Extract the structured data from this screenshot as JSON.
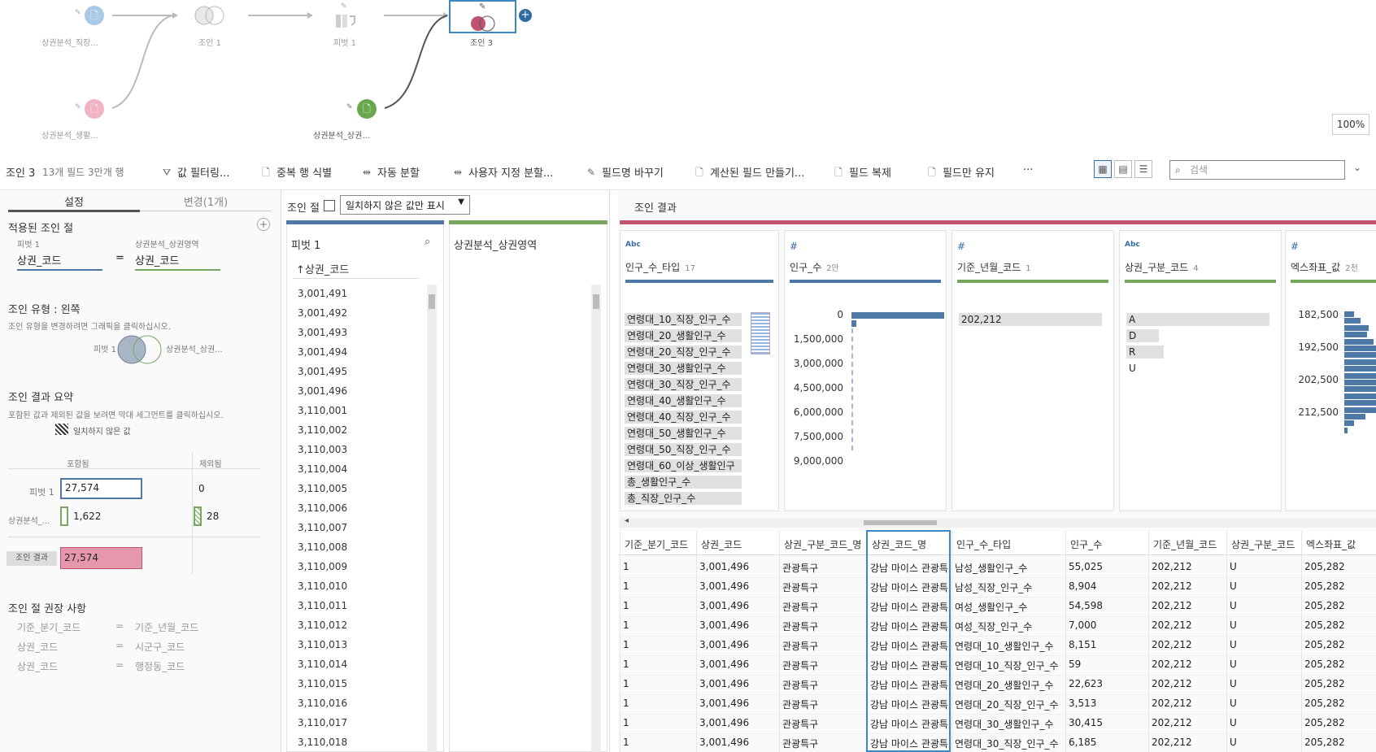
{
  "flow": {
    "nodes": {
      "src1": "상권분석_직장...",
      "join1": "조인 1",
      "pivot1": "피벗 1",
      "join3": "조인 3",
      "src2": "상권분석_생활...",
      "src3": "상권분석_상권..."
    },
    "zoom": "100%"
  },
  "toolbar": {
    "step_name": "조인 3",
    "step_meta": "13개 필드 3만개 행",
    "items": [
      "값 필터링...",
      "중복 행 식별",
      "자동 분할",
      "사용자 지정 분할...",
      "필드명 바꾸기",
      "계산된 필드 만들기...",
      "필드 복제",
      "필드만 유지",
      "···"
    ],
    "search_placeholder": "검색"
  },
  "left": {
    "tabs": [
      "설정",
      "변경(1개)"
    ],
    "applied_title": "적용된 조인 절",
    "left_source": "피벗 1",
    "right_source": "상권분석_상권영역",
    "left_field": "상권_코드",
    "eq": "=",
    "right_field": "상권_코드",
    "join_type_title": "조인 유형 : 왼쪽",
    "join_type_hint": "조인 유형을 변경하려면 그래픽을 클릭하십시오.",
    "venn_left": "피벗 1",
    "venn_right": "상권분석_상권...",
    "summary_title": "조인 결과 요약",
    "summary_hint": "포함된 값과 제외된 값을 보려면 막대 세그먼트를 클릭하십시오.",
    "unmatched_label": "일치하지 않은 값",
    "col_included": "포함됨",
    "col_excluded": "제외됨",
    "row1_label": "피벗 1",
    "row1_included": "27,574",
    "row1_excluded": "0",
    "row2_label": "상권분석_...",
    "row2_included": "1,622",
    "row2_excluded": "28",
    "row3_label": "조인 결과",
    "row3_included": "27,574",
    "rec_title": "조인 절 권장 사항",
    "recs": [
      {
        "l": "기준_분기_코드",
        "eq": "=",
        "r": "기준_년월_코드"
      },
      {
        "l": "상권_코드",
        "eq": "=",
        "r": "시군구_코드"
      },
      {
        "l": "상권_코드",
        "eq": "=",
        "r": "행정동_코드"
      }
    ]
  },
  "middle": {
    "title": "조인 절",
    "dropdown": "일치하지 않은 값만 표시",
    "left_source": "피벗 1",
    "right_source": "상권분석_상권영역",
    "field_header": "↑상권_코드",
    "values": [
      "3,001,491",
      "3,001,492",
      "3,001,493",
      "3,001,494",
      "3,001,495",
      "3,001,496",
      "3,110,001",
      "3,110,002",
      "3,110,003",
      "3,110,004",
      "3,110,005",
      "3,110,006",
      "3,110,007",
      "3,110,008",
      "3,110,009",
      "3,110,010",
      "3,110,011",
      "3,110,012",
      "3,110,013",
      "3,110,014",
      "3,110,015",
      "3,110,016",
      "3,110,017",
      "3,110,018"
    ]
  },
  "right": {
    "title": "조인 결과",
    "profiles": [
      {
        "type": "Abc",
        "name": "인구_수_타입",
        "count": "17",
        "color": "#4e79a7",
        "categories": [
          "연령대_10_직장_인구_수",
          "연령대_20_생활인구_수",
          "연령대_20_직장_인구_수",
          "연령대_30_생활인구_수",
          "연령대_30_직장_인구_수",
          "연령대_40_생활인구_수",
          "연령대_40_직장_인구_수",
          "연령대_50_생활인구_수",
          "연령대_50_직장_인구_수",
          "연령대_60_이상_생활인구",
          "총_생활인구_수",
          "총_직장_인구_수"
        ]
      },
      {
        "type": "#",
        "name": "인구_수",
        "count": "2만",
        "color": "#4e79a7",
        "ticks": [
          "0",
          "1,500,000",
          "3,000,000",
          "4,500,000",
          "6,000,000",
          "7,500,000",
          "9,000,000"
        ]
      },
      {
        "type": "#",
        "name": "기준_년월_코드",
        "count": "1",
        "color": "#76a660",
        "categories": [
          "202,212"
        ]
      },
      {
        "type": "Abc",
        "name": "상권_구분_코드",
        "count": "4",
        "color": "#76a660",
        "categories": [
          "A",
          "D",
          "R",
          "U"
        ]
      },
      {
        "type": "#",
        "name": "엑스좌표_값",
        "count": "2천",
        "color": "#76a660",
        "ticks": [
          "182,500",
          "192,500",
          "202,500",
          "212,500"
        ]
      }
    ],
    "columns": [
      "기준_분기_코드",
      "상권_코드",
      "상권_구분_코드_명",
      "상권_코드_명",
      "인구_수_타입",
      "인구_수",
      "기준_년월_코드",
      "상권_구분_코드",
      "엑스좌표_값"
    ],
    "rows": [
      [
        "1",
        "3,001,496",
        "관광특구",
        "강남 마이스 관광특",
        "남성_생활인구_수",
        "55,025",
        "202,212",
        "U",
        "205,282"
      ],
      [
        "1",
        "3,001,496",
        "관광특구",
        "강남 마이스 관광특",
        "남성_직장_인구_수",
        "8,904",
        "202,212",
        "U",
        "205,282"
      ],
      [
        "1",
        "3,001,496",
        "관광특구",
        "강남 마이스 관광특",
        "여성_생활인구_수",
        "54,598",
        "202,212",
        "U",
        "205,282"
      ],
      [
        "1",
        "3,001,496",
        "관광특구",
        "강남 마이스 관광특",
        "여성_직장_인구_수",
        "7,000",
        "202,212",
        "U",
        "205,282"
      ],
      [
        "1",
        "3,001,496",
        "관광특구",
        "강남 마이스 관광특",
        "연령대_10_생활인구_수",
        "8,151",
        "202,212",
        "U",
        "205,282"
      ],
      [
        "1",
        "3,001,496",
        "관광특구",
        "강남 마이스 관광특",
        "연령대_10_직장_인구_수",
        "59",
        "202,212",
        "U",
        "205,282"
      ],
      [
        "1",
        "3,001,496",
        "관광특구",
        "강남 마이스 관광특",
        "연령대_20_생활인구_수",
        "22,623",
        "202,212",
        "U",
        "205,282"
      ],
      [
        "1",
        "3,001,496",
        "관광특구",
        "강남 마이스 관광특",
        "연령대_20_직장_인구_수",
        "3,513",
        "202,212",
        "U",
        "205,282"
      ],
      [
        "1",
        "3,001,496",
        "관광특구",
        "강남 마이스 관광특",
        "연령대_30_생활인구_수",
        "30,415",
        "202,212",
        "U",
        "205,282"
      ],
      [
        "1",
        "3,001,496",
        "관광특구",
        "강남 마이스 관광특",
        "연령대_30_직장_인구_수",
        "6,185",
        "202,212",
        "U",
        "205,282"
      ]
    ]
  }
}
